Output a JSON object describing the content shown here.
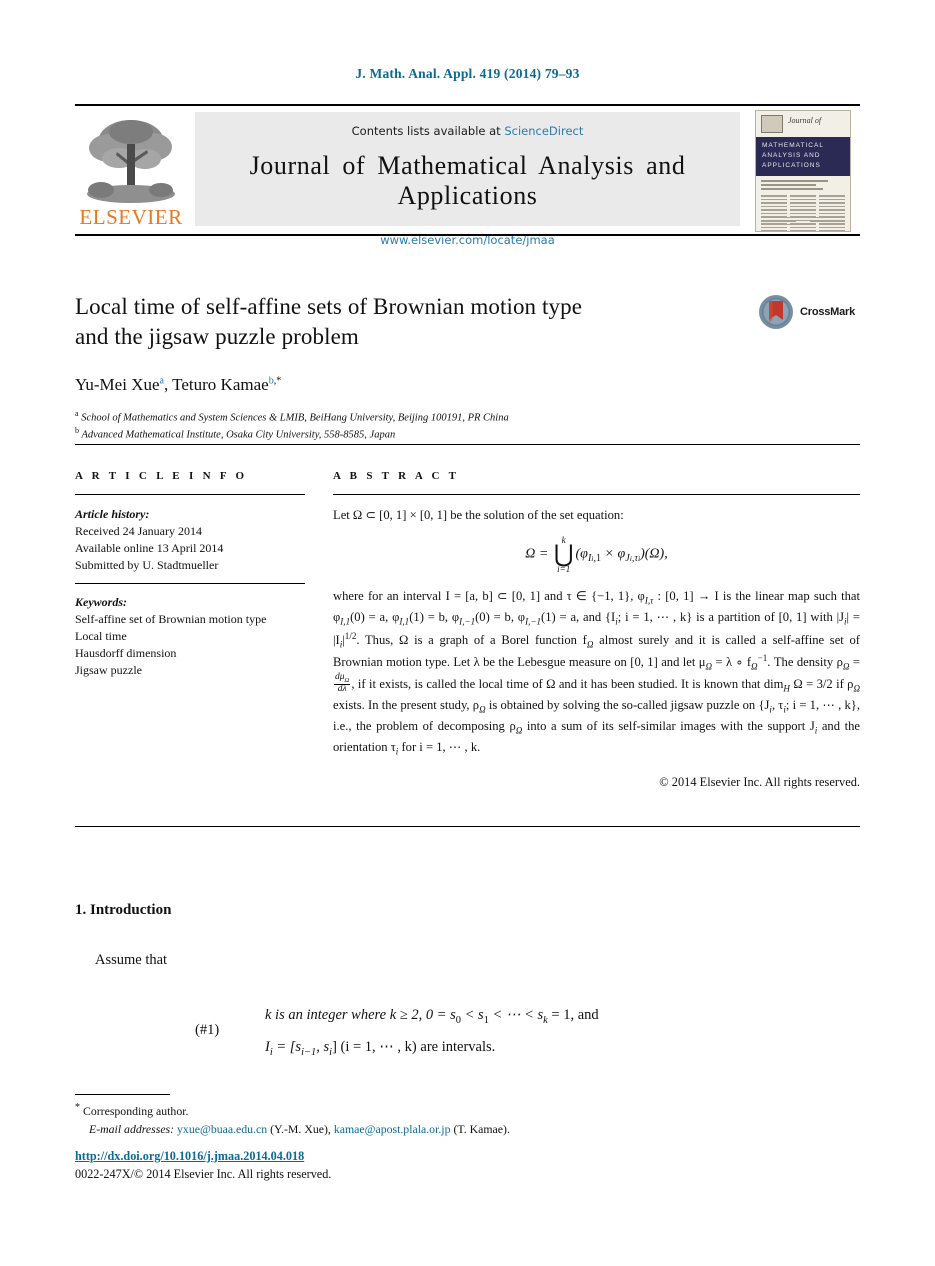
{
  "running_head": "J. Math. Anal. Appl. 419 (2014) 79–93",
  "masthead": {
    "contents_prefix": "Contents lists available at",
    "sciencedirect": "ScienceDirect",
    "journal_title": "Journal of Mathematical Analysis and Applications",
    "journal_url": "www.elsevier.com/locate/jmaa",
    "publisher": "ELSEVIER",
    "logo_icon": "elsevier-tree-icon",
    "cover": {
      "journal_of": "Journal of",
      "band_line1": "MATHEMATICAL",
      "band_line2": "ANALYSIS AND",
      "band_line3": "APPLICATIONS"
    }
  },
  "crossmark": {
    "label": "CrossMark",
    "icon": "crossmark-icon"
  },
  "title": {
    "line1": "Local time of self-affine sets of Brownian motion type",
    "line2": "and the jigsaw puzzle problem"
  },
  "authors": {
    "author1_name": "Yu-Mei Xue",
    "author1_mark": "a",
    "separator": ", ",
    "author2_name": "Teturo Kamae",
    "author2_mark": "b",
    "author2_star": ",*"
  },
  "affiliations": [
    {
      "mark": "a",
      "text": "School of Mathematics and System Sciences & LMIB, BeiHang University, Beijing 100191, PR China"
    },
    {
      "mark": "b",
      "text": "Advanced Mathematical Institute, Osaka City University, 558-8585, Japan"
    }
  ],
  "article_info": {
    "heading": "A R T I C L E   I N F O",
    "history_label": "Article history:",
    "history": [
      "Received 24 January 2014",
      "Available online 13 April 2014",
      "Submitted by U. Stadtmueller"
    ],
    "keywords_label": "Keywords:",
    "keywords": [
      "Self-affine set of Brownian motion type",
      "Local time",
      "Hausdorff dimension",
      "Jigsaw puzzle"
    ]
  },
  "abstract": {
    "heading": "A B S T R A C T",
    "lead": "Let Ω ⊂ [0, 1] × [0, 1] be the solution of the set equation:",
    "equation": {
      "lhs": "Ω =",
      "op": "⋃",
      "limit_top": "k",
      "limit_bottom": "i=1",
      "rhs_open": "(φ",
      "rhs_sub1": "I",
      "rhs_sub1b": "i",
      "rhs_sub1c": ",1",
      "rhs_times": " × φ",
      "rhs_sub2": "J",
      "rhs_sub2b": "i",
      "rhs_sub2c": ",τ",
      "rhs_sub2d": "i",
      "rhs_close": ")(Ω),"
    },
    "body_part1": "where for an interval I = [a, b] ⊂ [0, 1] and τ ∈ {−1, 1}, φ",
    "body_part1b": "I,τ",
    "body_part1c": " : [0, 1] → I is the linear map such that φ",
    "body_part2": "I,1",
    "body_part2b": "(0) = a, φ",
    "body_part3": "I,1",
    "body_part3b": "(1) = b, φ",
    "body_part4": "I,−1",
    "body_part4b": "(0) = b, φ",
    "body_part5": "I,−1",
    "body_part5b": "(1) = a, and {I",
    "body_part6": "i",
    "body_part6b": "; i = 1, ⋯ , k} is a partition of [0, 1] with |J",
    "body_part7": "i",
    "body_part7b": "| = |I",
    "body_part8": "i",
    "body_part8b": "|",
    "body_part9": "1/2",
    "body_part9b": ". Thus, Ω is a graph of a Borel function f",
    "body_part10": "Ω",
    "body_part10b": " almost surely and it is called a self-affine set of Brownian motion type. Let λ be the Lebesgue measure on [0, 1] and let μ",
    "body_part11": "Ω",
    "body_part11b": " = λ ∘ f",
    "body_part12": "Ω",
    "body_part12b": "−1",
    "body_part12c": ". The density ρ",
    "body_part13": "Ω",
    "body_part13b": " = ",
    "frac_num": "dμ",
    "frac_num_sub": "Ω",
    "frac_den": "dλ",
    "body_part14": ", if it exists, is called the local time of Ω and it has been studied. It is known that dim",
    "body_part15": "H",
    "body_part15b": " Ω = 3/2 if ρ",
    "body_part16": "Ω",
    "body_part16b": " exists. In the present study, ρ",
    "body_part17": "Ω",
    "body_part17b": " is obtained by solving the so-called jigsaw puzzle on {J",
    "body_part18": "i",
    "body_part18b": ", τ",
    "body_part19": "i",
    "body_part19b": "; i = 1, ⋯ , k}, i.e., the problem of decomposing ρ",
    "body_part20": "Ω",
    "body_part20b": " into a sum of its self-similar images with the support J",
    "body_part21": "i",
    "body_part21b": " and the orientation τ",
    "body_part22": "i",
    "body_part22b": " for i = 1, ⋯ , k.",
    "copyright": "© 2014 Elsevier Inc. All rights reserved."
  },
  "introduction": {
    "heading": "1.  Introduction",
    "assume": "Assume that",
    "eq_tag": "(#1)",
    "eq_line1_a": "k is an integer where k ≥ 2,  0 = s",
    "eq_line1_sub0": "0",
    "eq_line1_b": " < s",
    "eq_line1_sub1": "1",
    "eq_line1_c": " < ⋯ < s",
    "eq_line1_subk": "k",
    "eq_line1_d": " = 1,  and",
    "eq_line2_a": "I",
    "eq_line2_subi": "i",
    "eq_line2_b": " = [s",
    "eq_line2_subi1": "i−1",
    "eq_line2_c": ", s",
    "eq_line2_subi2": "i",
    "eq_line2_d": "] (i = 1, ⋯ , k) are intervals."
  },
  "footnotes": {
    "star": "*",
    "corresponding": "Corresponding author.",
    "email_label": "E-mail addresses:",
    "email1": "yxue@buaa.edu.cn",
    "email1_name": "(Y.-M. Xue),",
    "email2": "kamae@apost.plala.or.jp",
    "email2_name": "(T. Kamae)."
  },
  "footer": {
    "doi": "http://dx.doi.org/10.1016/j.jmaa.2014.04.018",
    "issn": "0022-247X/© 2014 Elsevier Inc. All rights reserved."
  }
}
